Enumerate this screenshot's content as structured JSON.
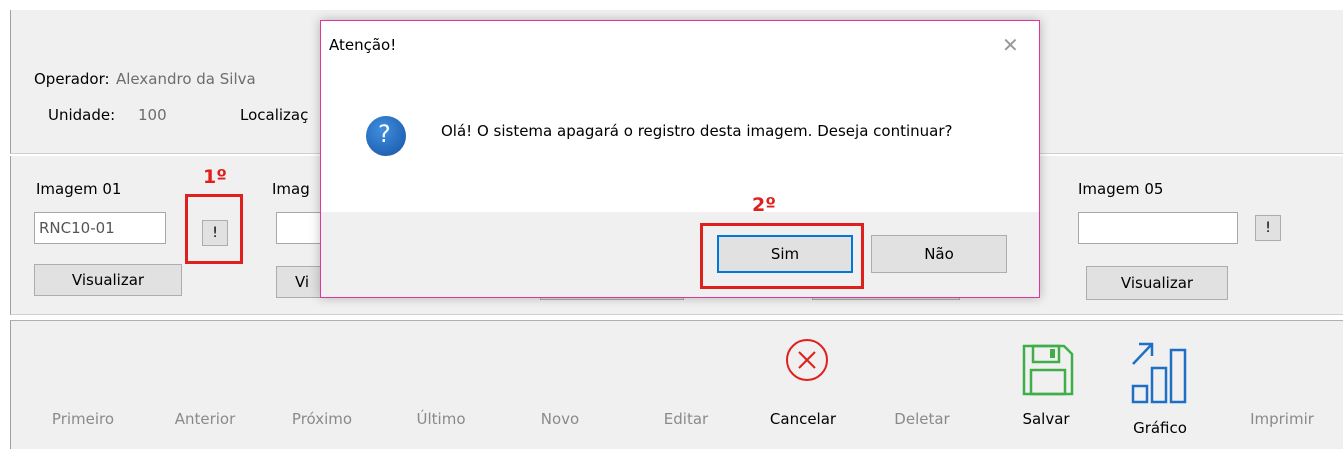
{
  "header": {
    "operator_label": "Operador:",
    "operator_value": "Alexandro da Silva",
    "unit_label": "Unidade:",
    "unit_value": "100",
    "location_label": "Localizaç"
  },
  "images": {
    "image01_label": "Imagem 01",
    "image01_value": "RNC10-01",
    "image02_label_partial": "Imag",
    "image05_label": "Imagem 05",
    "image05_value": "",
    "delete_btn_label": "!",
    "view_label": "Visualizar",
    "view_label_partial": "Vi"
  },
  "annotations": {
    "step1": "1º",
    "step2": "2º"
  },
  "dialog": {
    "title": "Atenção!",
    "close": "✕",
    "question_icon": "?",
    "message": "Olá! O sistema apagará o registro desta imagem. Deseja continuar?",
    "yes_label": "Sim",
    "no_label": "Não"
  },
  "toolbar": {
    "first": "Primeiro",
    "previous": "Anterior",
    "next": "Próximo",
    "last": "Último",
    "new": "Novo",
    "edit": "Editar",
    "cancel": "Cancelar",
    "delete": "Deletar",
    "save": "Salvar",
    "chart": "Gráfico",
    "print": "Imprimir"
  },
  "colors": {
    "accent_green": "#3fae49",
    "accent_blue": "#1f6fc4",
    "cancel_red": "#e0201c",
    "highlight_red": "#e0201c",
    "dialog_border": "#e0359b"
  }
}
